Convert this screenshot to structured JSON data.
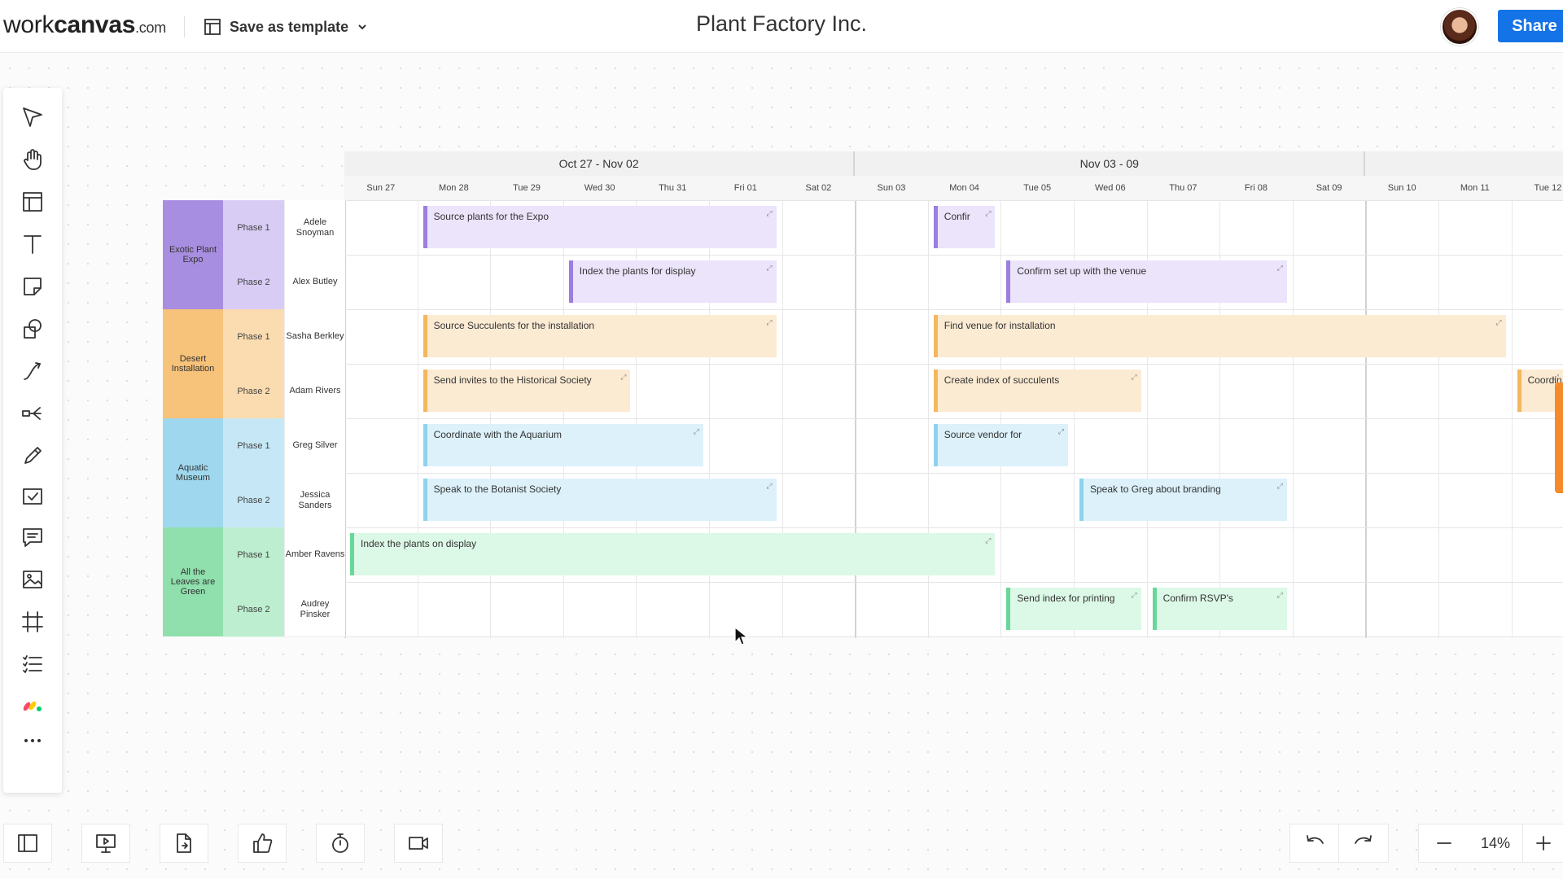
{
  "header": {
    "logo_prefix": "work",
    "logo_bold": "canvas",
    "logo_suffix": ".com",
    "save_template_label": "Save as template",
    "title": "Plant Factory Inc.",
    "share_label": "Share"
  },
  "toolbar": {
    "tools": [
      "select-tool",
      "pan-tool",
      "template-tool",
      "text-tool",
      "sticky-note-tool",
      "shapes-tool",
      "connector-tool",
      "mindmap-tool",
      "pen-tool",
      "checklist-tool",
      "comment-tool",
      "image-tool",
      "frame-tool",
      "list-tool",
      "integration-tool",
      "more-tool"
    ]
  },
  "bottom_bar": {
    "zoom_level": "14%"
  },
  "gantt": {
    "weeks": [
      "Oct 27 - Nov 02",
      "Nov 03 - 09"
    ],
    "days": [
      "Sun 27",
      "Mon 28",
      "Tue 29",
      "Wed 30",
      "Thu 31",
      "Fri 01",
      "Sat 02",
      "Sun 03",
      "Mon 04",
      "Tue 05",
      "Wed 06",
      "Thu 07",
      "Fri 08",
      "Sat 09",
      "Sun 10",
      "Mon 11",
      "Tue 12"
    ],
    "groups": [
      {
        "name": "Exotic Plant Expo",
        "color": "#a88ee0",
        "phase_color": "#d8ccf5",
        "rows": [
          {
            "phase": "Phase 1",
            "owner": "Adele Snoyman"
          },
          {
            "phase": "Phase 2",
            "owner": "Alex Butley"
          }
        ]
      },
      {
        "name": "Desert Installation",
        "color": "#f7c27a",
        "phase_color": "#fbdcb0",
        "rows": [
          {
            "phase": "Phase 1",
            "owner": "Sasha Berkley"
          },
          {
            "phase": "Phase 2",
            "owner": "Adam Rivers"
          }
        ]
      },
      {
        "name": "Aquatic Museum",
        "color": "#9fd8ee",
        "phase_color": "#c6e8f6",
        "rows": [
          {
            "phase": "Phase 1",
            "owner": "Greg Silver"
          },
          {
            "phase": "Phase 2",
            "owner": "Jessica Sanders"
          }
        ]
      },
      {
        "name": "All the Leaves are Green",
        "color": "#8fe0ac",
        "phase_color": "#bdeecf",
        "rows": [
          {
            "phase": "Phase 1",
            "owner": "Amber Ravens"
          },
          {
            "phase": "Phase 2",
            "owner": "Audrey Pinsker"
          }
        ]
      }
    ],
    "tasks": [
      {
        "label": "Source plants for the Expo",
        "row": 0,
        "start": 1,
        "days": 5,
        "color": "purple"
      },
      {
        "label": "Confir",
        "row": 0,
        "start": 8,
        "days": 1,
        "color": "purple"
      },
      {
        "label": "Index the plants for display",
        "row": 1,
        "start": 3,
        "days": 3,
        "color": "purple"
      },
      {
        "label": "Confirm set up with the venue",
        "row": 1,
        "start": 9,
        "days": 4,
        "color": "purple"
      },
      {
        "label": "Source Succulents for the installation",
        "row": 2,
        "start": 1,
        "days": 5,
        "color": "orange"
      },
      {
        "label": "Find venue for installation",
        "row": 2,
        "start": 8,
        "days": 8,
        "color": "orange"
      },
      {
        "label": "Send invites to the Historical Society",
        "row": 3,
        "start": 1,
        "days": 3,
        "color": "orange"
      },
      {
        "label": "Create index of succulents",
        "row": 3,
        "start": 8,
        "days": 3,
        "color": "orange"
      },
      {
        "label": "Coordin",
        "row": 3,
        "start": 16,
        "days": 1,
        "color": "orange"
      },
      {
        "label": "Coordinate with the Aquarium",
        "row": 4,
        "start": 1,
        "days": 4,
        "color": "blue"
      },
      {
        "label": "Source vendor for",
        "row": 4,
        "start": 8,
        "days": 2,
        "color": "blue"
      },
      {
        "label": "Speak to the Botanist Society",
        "row": 5,
        "start": 1,
        "days": 5,
        "color": "blue"
      },
      {
        "label": "Speak to Greg about branding",
        "row": 5,
        "start": 10,
        "days": 3,
        "color": "blue"
      },
      {
        "label": "Index the plants on display",
        "row": 6,
        "start": 0,
        "days": 9,
        "color": "green"
      },
      {
        "label": "Send index for printing",
        "row": 7,
        "start": 9,
        "days": 2,
        "color": "green"
      },
      {
        "label": "Confirm RSVP's",
        "row": 7,
        "start": 11,
        "days": 2,
        "color": "green"
      }
    ]
  }
}
